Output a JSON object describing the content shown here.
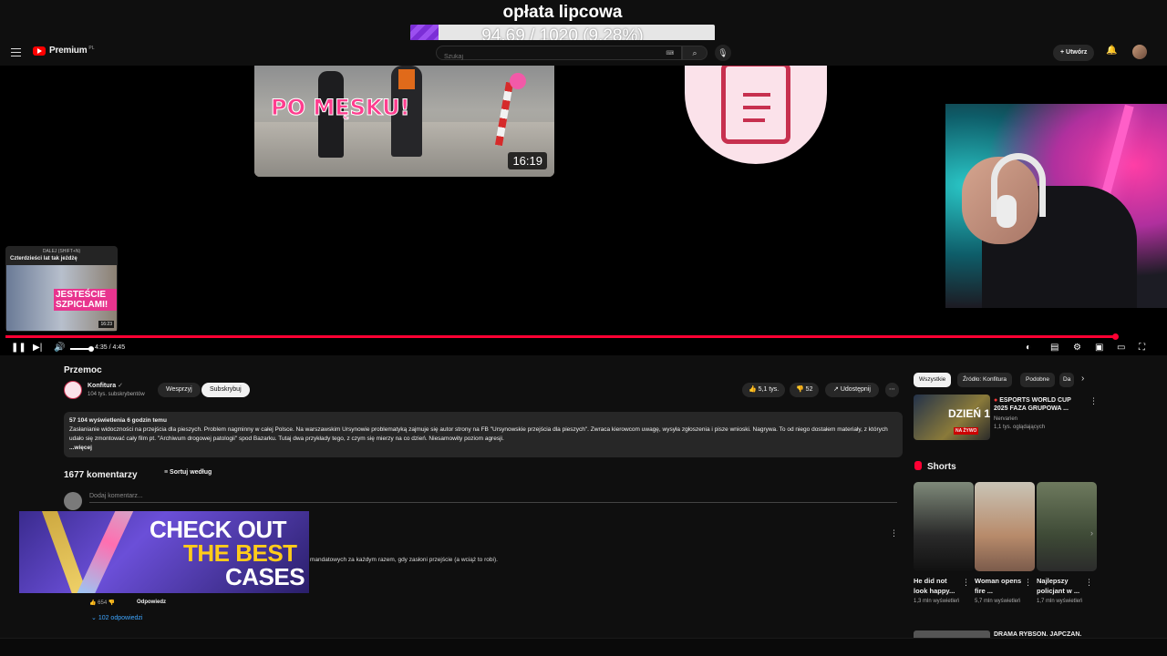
{
  "overlay": {
    "title": "opłata lipcowa",
    "progress_label": "94.69 / 1020 (9.28%)",
    "progress_fraction": 0.0928,
    "accent": "#8a3ae6"
  },
  "header": {
    "logo_text": "Premium",
    "logo_region": "PL",
    "search_placeholder": "Szukaj",
    "create_label": "Utwórz",
    "accent": "#ff0000"
  },
  "player": {
    "thumb_text": "PO MĘSKU!",
    "thumb_duration": "16:19",
    "next": {
      "label": "DALEJ (SHIFT+N)",
      "title": "Czterdzieści lat tak jeżdżę",
      "thumb_text": "JESTEŚCIE SZPICLAMI!",
      "duration": "16:23"
    },
    "time": "4:35 / 4:45",
    "progress_fraction": 0.965
  },
  "video": {
    "title": "Przemoc",
    "channel": "Konfitura",
    "subs": "104 tys. subskrybentów",
    "support_label": "Wesprzyj",
    "subscribe_label": "Subskrybuj",
    "likes": "5,1 tys.",
    "dislikes": "52",
    "share_label": "Udostępnij",
    "desc_stats": "57 104 wyświetlenia  6 godzin temu",
    "desc_text": "Zasłanianie widoczności na przejścia dla pieszych. Problem nagminny w całej Polsce. Na warszawskim Ursynowie problematyką zajmuje się autor strony na FB \"Ursynowskie przejścia dla pieszych\". Zwraca kierowcom uwagę, wysyła zgłoszenia i pisze wnioski. Nagrywa. To od niego dostałem materiały, z których udało się zmontować cały film pt. \"Archiwum drogowej patologii\" spod Bazarku. Tutaj dwa przykłady tego, z czym się mierzy na co dzień. Niesamowity poziom agresji.",
    "desc_more": "...więcej"
  },
  "comments": {
    "heading": "1677 komentarzy",
    "sort_label": "Sortuj według",
    "input_placeholder": "Dodaj komentarz...",
    "text": "mandatowych za każdym razem, gdy zasłoni przejście (a wciąż to robi).",
    "likes": "654",
    "reply_label": "Odpowiedz",
    "replies_label": "102 odpowiedzi"
  },
  "ad": {
    "line1": "CHECK OUT",
    "line2": "THE BEST",
    "line3": "CASES"
  },
  "sidebar": {
    "chips": [
      "Wszystkie",
      "Źródło: Konfitura",
      "Podobne",
      "Da"
    ],
    "live": {
      "thumb_day": "DZIEŃ 1",
      "badge": "NA ŻYWO",
      "title": "ESPORTS WORLD CUP 2025 FAZA GRUPOWA ...",
      "channel": "Nervarien",
      "viewers": "1,1 tys. oglądających"
    },
    "shorts_heading": "Shorts",
    "shorts": [
      {
        "title": "He did not look happy...",
        "views": "1,3 mln wyświetleń"
      },
      {
        "title": "Woman opens fire ...",
        "views": "5,7 mln wyświetleń"
      },
      {
        "title": "Najlepszy policjant w ...",
        "views": "1,7 mln wyświetleń"
      }
    ],
    "next_title": "DRAMA RYBSON. JAPCZAN."
  }
}
